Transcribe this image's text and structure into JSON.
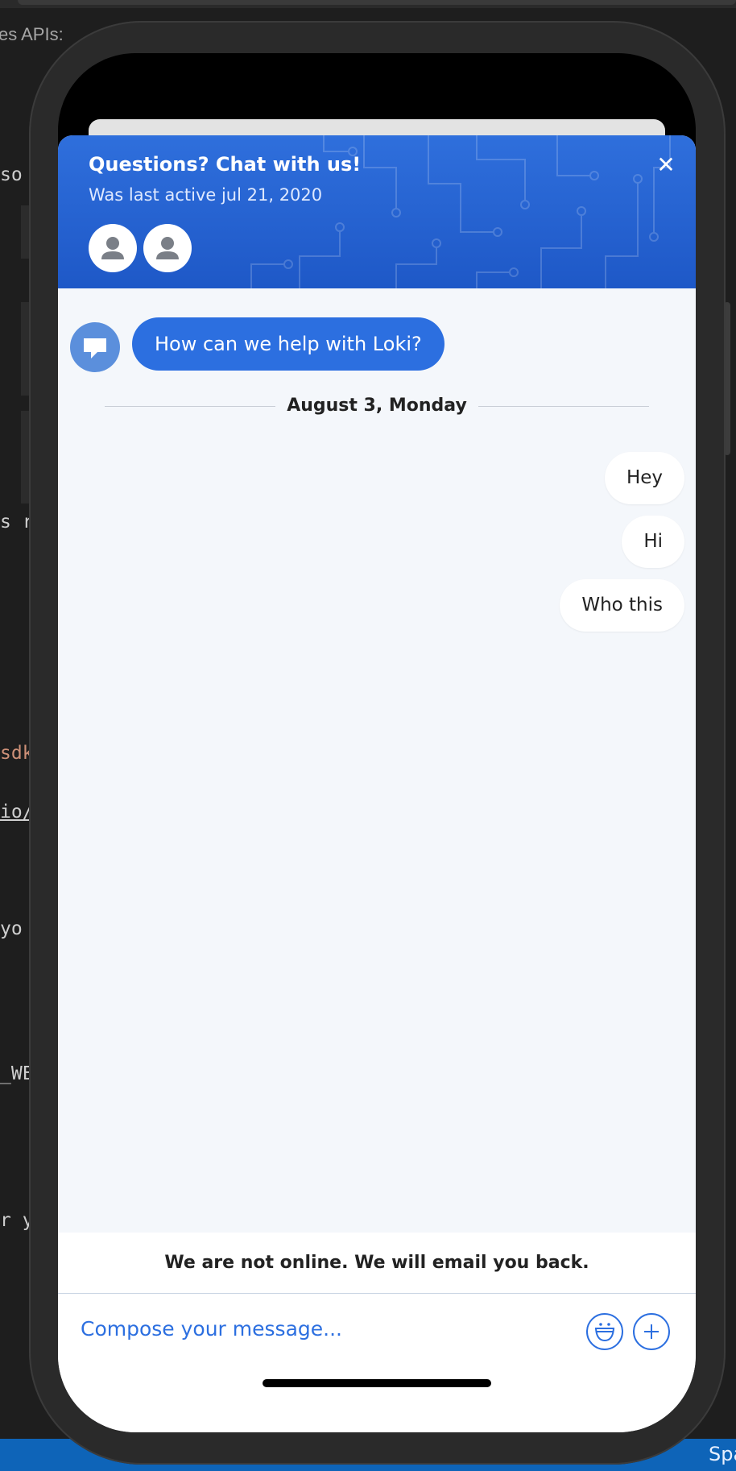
{
  "editor": {
    "tab_title": "es APIs:",
    "fragments": [
      "so",
      "s r",
      "sdk",
      "io/",
      "yo",
      "_WE",
      "r y"
    ],
    "status_right": "Spa"
  },
  "widget": {
    "title": "Questions? Chat with us!",
    "subtitle": "Was last active jul 21, 2020",
    "close_glyph": "✕",
    "bot_message": "How can we help with Loki?",
    "date_label": "August 3, Monday",
    "messages": [
      "Hey",
      "Hi",
      "Who this"
    ],
    "offline_notice": "We are not online. We will email you back.",
    "compose_placeholder": "Compose your message..."
  },
  "icons": {
    "close": "close-icon",
    "agent_avatar": "user-silhouette-icon",
    "bot": "chat-bubble-icon",
    "emoji": "smiley-icon",
    "attach": "plus-icon"
  },
  "colors": {
    "header": "#2563d9",
    "accent": "#2c6fe0",
    "chat_background": "#f4f7fb",
    "editor_background": "#1e1e1e",
    "status_bar": "#0e64b8"
  }
}
